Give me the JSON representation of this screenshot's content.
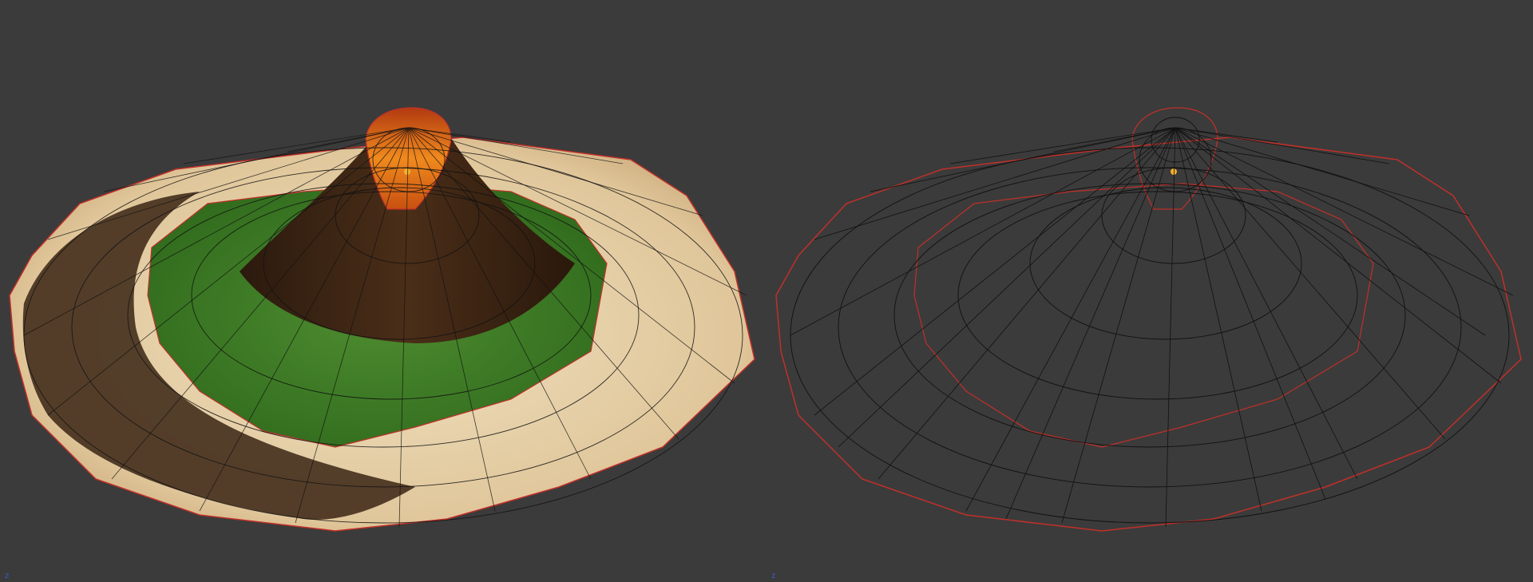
{
  "viewports": [
    {
      "mode": "shaded",
      "axis_label": "z"
    },
    {
      "mode": "wireframe",
      "axis_label": "z"
    }
  ],
  "colors": {
    "background": "#3b3b3b",
    "wire": "#111111",
    "outline_red": "#c0302a",
    "sand": "#e6d0a8",
    "grass": "#3e7a26",
    "rock": "#3a2414",
    "lava": "#e0661a",
    "axis_blue": "#3a5cc8"
  },
  "icons": {
    "vertex_marker": "vertex-dot-icon"
  }
}
